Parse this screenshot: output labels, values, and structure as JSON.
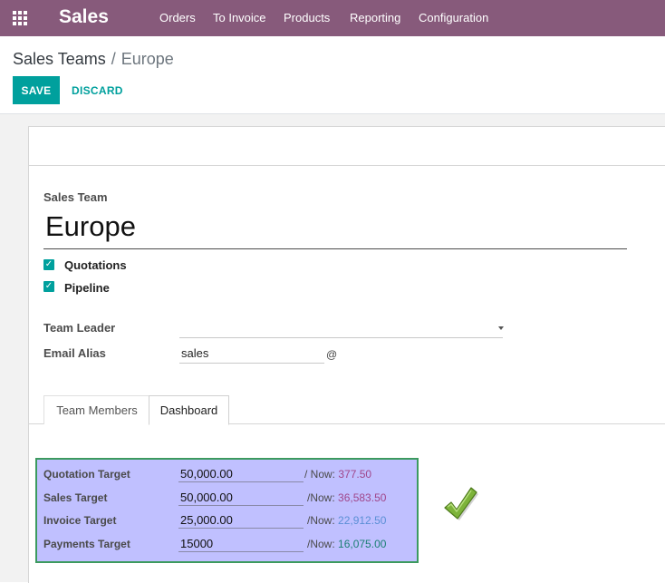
{
  "navbar": {
    "app_name": "Sales",
    "menu": [
      "Orders",
      "To Invoice",
      "Products",
      "Reporting",
      "Configuration"
    ],
    "color": "#875A7B"
  },
  "breadcrumb": {
    "parent": "Sales Teams",
    "separator": "/",
    "current": "Europe"
  },
  "buttons": {
    "save": "SAVE",
    "discard": "DISCARD",
    "accent": "#00A09D"
  },
  "form": {
    "sales_team_label": "Sales Team",
    "team_name": "Europe",
    "checkboxes": [
      {
        "label": "Quotations",
        "checked": true
      },
      {
        "label": "Pipeline",
        "checked": true
      }
    ],
    "team_leader_label": "Team Leader",
    "team_leader_value": "",
    "email_alias_label": "Email Alias",
    "email_alias_value": "sales",
    "email_alias_suffix": "@"
  },
  "tabs": [
    {
      "label": "Team Members",
      "active": false
    },
    {
      "label": "Dashboard",
      "active": true
    }
  ],
  "targets": [
    {
      "label": "Quotation Target",
      "value": "50,000.00",
      "now_label": "/ Now:",
      "now_value": "377.50",
      "now_color": "#A0468B"
    },
    {
      "label": "Sales Target",
      "value": "50,000.00",
      "now_label": "/Now:",
      "now_value": "36,583.50",
      "now_color": "#A0468B"
    },
    {
      "label": "Invoice Target",
      "value": "25,000.00",
      "now_label": "/Now:",
      "now_value": "22,912.50",
      "now_color": "#5B8FD6"
    },
    {
      "label": "Payments Target",
      "value": "15000",
      "now_label": "/Now:",
      "now_value": "16,075.00",
      "now_color": "#1A7F73"
    }
  ],
  "icons": {
    "apps": "apps-grid-icon",
    "status": "checkmark-icon"
  }
}
